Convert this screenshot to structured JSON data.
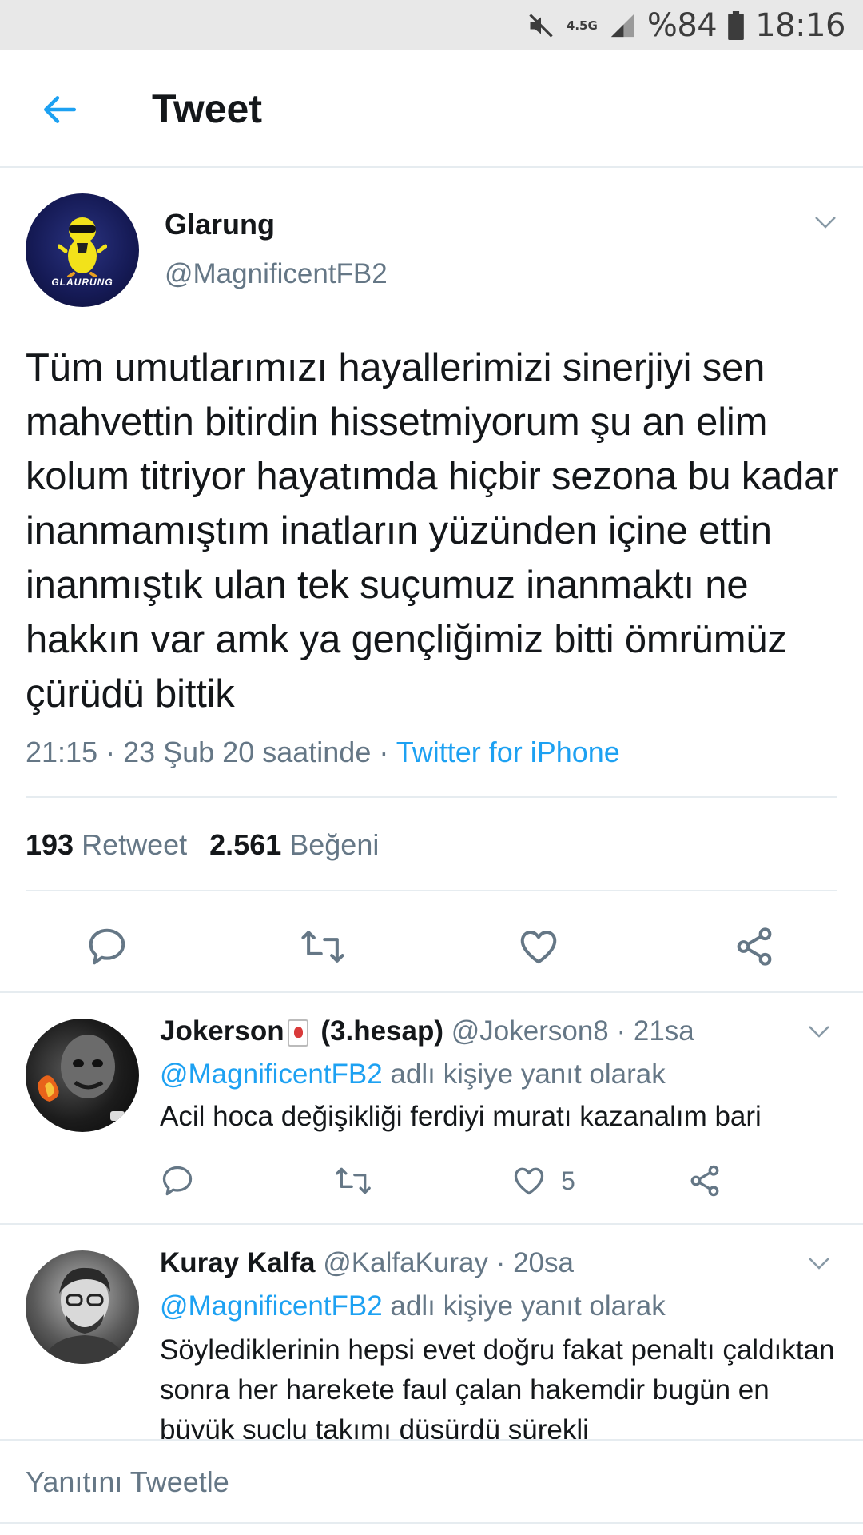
{
  "status_bar": {
    "network": "4.5G",
    "battery": "%84",
    "time": "18:16"
  },
  "header": {
    "title": "Tweet"
  },
  "tweet": {
    "author_name": "Glarung",
    "author_handle": "@MagnificentFB2",
    "avatar_text": "GLAURUNG",
    "text": "Tüm umutlarımızı hayallerimizi sinerjiyi sen mahvettin bitirdin hissetmiyorum şu an elim kolum titriyor hayatımda hiçbir sezona bu kadar inanmamıştım inatların yüzünden içine ettin inanmıştık ulan tek suçumuz inanmaktı ne hakkın var amk ya gençliğimiz bitti ömrümüz çürüdü bittik",
    "timestamp": "21:15 · 23 Şub 20 saatinde · ",
    "source": "Twitter for iPhone",
    "retweet_count": "193",
    "retweet_label": "Retweet",
    "like_count": "2.561",
    "like_label": "Beğeni"
  },
  "replies": [
    {
      "name": "Jokerson",
      "name_suffix": " (3.hesap)",
      "handle_time": " @Jokerson8 · 21sa",
      "reply_to_mention": "@MagnificentFB2",
      "reply_to_text": " adlı kişiye yanıt olarak",
      "text": "Acil hoca değişikliği ferdiyi muratı kazanalım bari",
      "like_count": "5"
    },
    {
      "name": "Kuray Kalfa",
      "handle_time": " @KalfaKuray · 20sa",
      "reply_to_mention": "@MagnificentFB2",
      "reply_to_text": " adlı kişiye yanıt olarak",
      "text": "Söylediklerinin hepsi evet doğru fakat penaltı çaldıktan sonra her harekete faul çalan hakemdir bugün en büyük suçlu takımı düşürdü sürekli"
    }
  ],
  "composer": {
    "placeholder": "Yanıtını Tweetle"
  },
  "colors": {
    "accent": "#1da1f2",
    "secondary_text": "#657786",
    "divider": "#e6ecf0"
  }
}
